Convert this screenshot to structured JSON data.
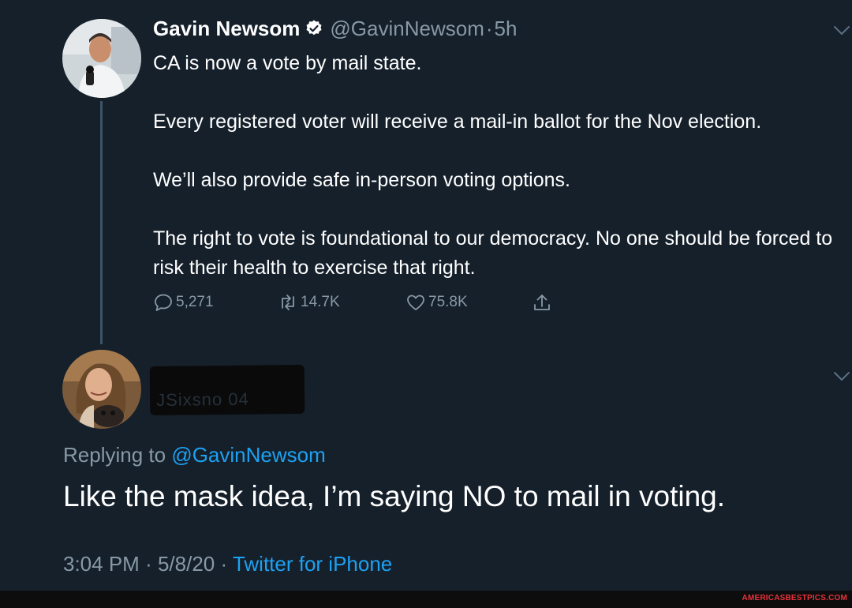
{
  "tweet": {
    "author_name": "Gavin Newsom",
    "verified_icon": "verified-badge-icon",
    "handle": "@GavinNewsom",
    "separator": "·",
    "time_ago": "5h",
    "paragraphs": [
      "CA is now a vote by mail state.",
      "Every registered voter will receive a mail-in ballot for the Nov election.",
      "We’ll also provide safe in-person voting options.",
      "The right to vote is foundational to our democracy. No one should be forced to risk their health to exercise that right."
    ],
    "actions": {
      "replies": "5,271",
      "retweets": "14.7K",
      "likes": "75.8K"
    }
  },
  "reply": {
    "redacted_handle_fragment": "JSixsno 04",
    "replying_prefix": "Replying to",
    "replying_mention": "@GavinNewsom",
    "text": "Like the mask idea, I’m saying NO to mail in voting.",
    "time": "3:04 PM",
    "separator": "·",
    "date": "5/8/20",
    "source": "Twitter for iPhone"
  },
  "watermark": "AMERICASBESTPICS.COM",
  "colors": {
    "background": "#15202b",
    "secondary_text": "#8899a6",
    "link": "#1da1f2",
    "thread_line": "#3d5466",
    "watermark": "#e8323c"
  }
}
